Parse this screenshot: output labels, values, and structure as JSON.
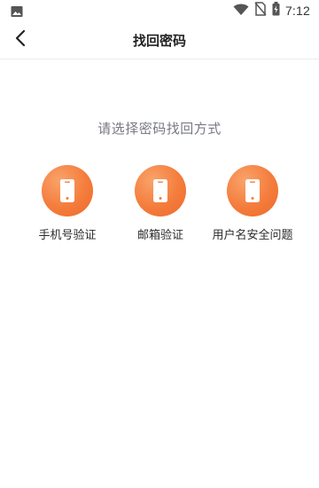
{
  "status_bar": {
    "time": "7:12",
    "icons": [
      "image-icon",
      "wifi-icon",
      "no-sim-icon",
      "battery-charging-icon"
    ]
  },
  "header": {
    "title": "找回密码",
    "back_icon": "chevron-left-icon"
  },
  "main": {
    "prompt": "请选择密码找回方式",
    "options": [
      {
        "label": "手机号验证",
        "icon": "phone-icon"
      },
      {
        "label": "邮箱验证",
        "icon": "phone-icon"
      },
      {
        "label": "用户名安全问题",
        "icon": "phone-icon"
      }
    ]
  },
  "colors": {
    "accent": "#f47c3c",
    "text_primary": "#222222",
    "text_secondary": "#777a82"
  }
}
